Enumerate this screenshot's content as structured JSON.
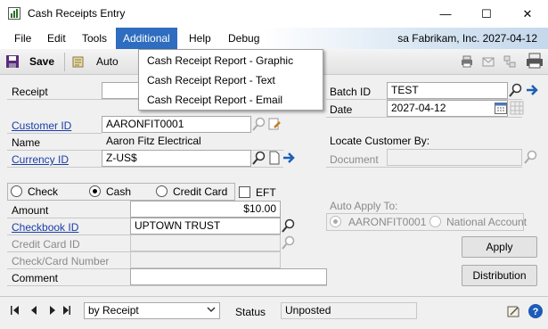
{
  "window": {
    "title": "Cash Receipts Entry",
    "minimize": "—",
    "maximize": "☐",
    "close": "✕"
  },
  "menu": {
    "items": [
      "File",
      "Edit",
      "Tools",
      "Additional",
      "Help",
      "Debug"
    ],
    "company_info": "sa  Fabrikam, Inc.  2027-04-12"
  },
  "toolbar": {
    "save_label": "Save",
    "auto_label": "Auto"
  },
  "dropdown": {
    "items": [
      "Cash Receipt Report - Graphic",
      "Cash Receipt Report - Text",
      "Cash Receipt Report - Email"
    ]
  },
  "form": {
    "receipt_label": "Receipt",
    "batch_id_label": "Batch ID",
    "batch_id_value": "TEST",
    "date_label": "Date",
    "date_value": "2027-04-12",
    "customer_id_label": "Customer ID",
    "customer_id_value": "AARONFIT0001",
    "name_label": "Name",
    "name_value": "Aaron Fitz Electrical",
    "currency_id_label": "Currency ID",
    "currency_id_value": "Z-US$",
    "locate_label": "Locate Customer By:",
    "document_label": "Document",
    "payment_types": [
      "Check",
      "Cash",
      "Credit Card"
    ],
    "payment_selected": "Cash",
    "eft_label": "EFT",
    "amount_label": "Amount",
    "amount_value": "$10.00",
    "checkbook_id_label": "Checkbook ID",
    "checkbook_id_value": "UPTOWN TRUST",
    "credit_card_id_label": "Credit Card ID",
    "check_card_number_label": "Check/Card Number",
    "comment_label": "Comment",
    "auto_apply_label": "Auto Apply To:",
    "auto_apply_options": [
      "AARONFIT0001",
      "National Account"
    ],
    "apply_button": "Apply",
    "distribution_button": "Distribution"
  },
  "status": {
    "sort_value": "by Receipt",
    "status_label": "Status",
    "status_value": "Unposted"
  }
}
